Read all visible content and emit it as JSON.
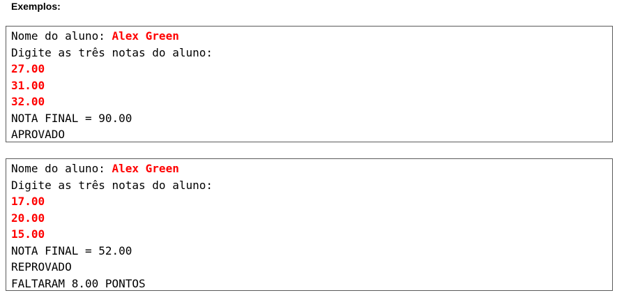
{
  "heading": "Exemplos:",
  "examples": [
    {
      "name_prompt": "Nome do aluno: ",
      "name_input": "Alex Green",
      "grades_prompt": "Digite as três notas do aluno:",
      "grades": [
        "27.00",
        "31.00",
        "32.00"
      ],
      "final_grade": "NOTA FINAL = 90.00",
      "status": "APROVADO"
    },
    {
      "name_prompt": "Nome do aluno: ",
      "name_input": "Alex Green",
      "grades_prompt": "Digite as três notas do aluno:",
      "grades": [
        "17.00",
        "20.00",
        "15.00"
      ],
      "final_grade": "NOTA FINAL = 52.00",
      "status": "REPROVADO",
      "missing": "FALTARAM 8.00 PONTOS"
    }
  ]
}
